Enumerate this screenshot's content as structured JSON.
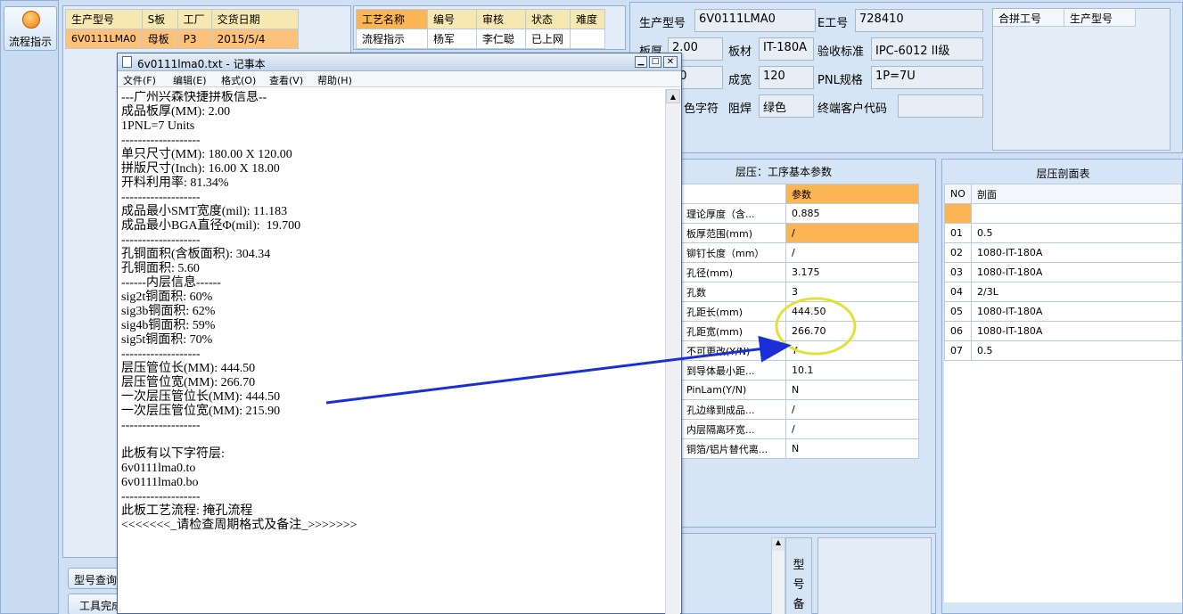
{
  "left_toolbar": {
    "flow_button": "流程指示"
  },
  "order_table": {
    "headers": [
      "生产型号",
      "S板",
      "工厂",
      "交货日期"
    ],
    "rows": [
      [
        "6V0111LMA0",
        "母板",
        "P3",
        "2015/5/4"
      ]
    ]
  },
  "process_table": {
    "headers": [
      "工艺名称",
      "编号",
      "审核",
      "状态",
      "难度"
    ],
    "rows": [
      [
        "流程指示",
        "杨军",
        "李仁聪",
        "已上网",
        ""
      ]
    ]
  },
  "bottom_buttons": {
    "model_query": "型号查询",
    "tool_done": "工具完成"
  },
  "info": {
    "model_label": "生产型号",
    "model_value": "6V0111LMA0",
    "e_label": "E工号",
    "e_value": "728410",
    "thickness_label": "板厚",
    "thickness_value": "2.00",
    "material_label": "板材",
    "material_value": "IT-180A",
    "accept_label": "验收标准",
    "accept_value": "IPC-6012 II级",
    "r2_value": "80",
    "width_label": "成宽",
    "width_value": "120",
    "pnl_label": "PNL规格",
    "pnl_value": "1P=7U",
    "char_label": "色字符",
    "mask_label": "阻焊",
    "mask_value": "绿色",
    "cust_label": "终端客户代码",
    "cust_value": ""
  },
  "merge_table": {
    "headers": [
      "合拼工号",
      "生产型号"
    ]
  },
  "lamination_params": {
    "title": "层压：工序基本参数",
    "value_header": "参数",
    "rows": [
      {
        "name": "理论厚度（含...",
        "value": "0.885"
      },
      {
        "name": "板厚范围(mm)",
        "value": "/"
      },
      {
        "name": "铆钉长度（mm）",
        "value": "/"
      },
      {
        "name": "孔径(mm)",
        "value": "3.175"
      },
      {
        "name": "孔数",
        "value": "3"
      },
      {
        "name": "孔距长(mm)",
        "value": "444.50"
      },
      {
        "name": "孔距宽(mm)",
        "value": "266.70"
      },
      {
        "name": "不可更改(Y/N)",
        "value": "Y"
      },
      {
        "name": "到导体最小距...",
        "value": "10.1"
      },
      {
        "name": "PinLam(Y/N)",
        "value": "N"
      },
      {
        "name": "孔边缘到成品...",
        "value": "/"
      },
      {
        "name": "内层隔离环宽...",
        "value": "/"
      },
      {
        "name": "铜箔/铝片替代离...",
        "value": "N"
      }
    ]
  },
  "stackup": {
    "title": "层压剖面表",
    "headers": [
      "NO",
      "剖面"
    ],
    "rows": [
      [
        "01",
        "0.5"
      ],
      [
        "02",
        "1080-IT-180A"
      ],
      [
        "03",
        "1080-IT-180A"
      ],
      [
        "04",
        "2/3L"
      ],
      [
        "05",
        "1080-IT-180A"
      ],
      [
        "06",
        "1080-IT-180A"
      ],
      [
        "07",
        "0.5"
      ]
    ]
  },
  "remark_label": [
    "型",
    "号",
    "备"
  ],
  "notepad": {
    "title": "6v0111lma0.txt - 记事本",
    "menu": [
      "文件(F)",
      "编辑(E)",
      "格式(O)",
      "查看(V)",
      "帮助(H)"
    ],
    "lines": [
      "---广州兴森快捷拼板信息--",
      "成品板厚(MM): 2.00",
      "1PNL=7 Units",
      "-------------------",
      "单只尺寸(MM): 180.00 X 120.00",
      "拼版尺寸(Inch): 16.00 X 18.00",
      "开料利用率: 81.34%",
      "-------------------",
      "成品最小SMT宽度(mil): 11.183",
      "成品最小BGA直径Φ(mil):  19.700",
      "-------------------",
      "孔铜面积(含板面积): 304.34",
      "孔铜面积: 5.60",
      "------内层信息------",
      "sig2t铜面积: 60%",
      "sig3b铜面积: 62%",
      "sig4b铜面积: 59%",
      "sig5t铜面积: 70%",
      "-------------------",
      "层压管位长(MM): 444.50",
      "层压管位宽(MM): 266.70",
      "一次层压管位长(MM): 444.50",
      "一次层压管位宽(MM): 215.90",
      "-------------------",
      "",
      "此板有以下字符层:",
      "6v0111lma0.to",
      "6v0111lma0.bo",
      "-------------------",
      "此板工艺流程: 掩孔流程",
      "<<<<<<<_请检查周期格式及备注_>>>>>>>"
    ]
  },
  "colors": {
    "accent": "#fbb554",
    "annotation_arrow": "#1a2fd6",
    "annotation_circle": "#e4e03a"
  }
}
